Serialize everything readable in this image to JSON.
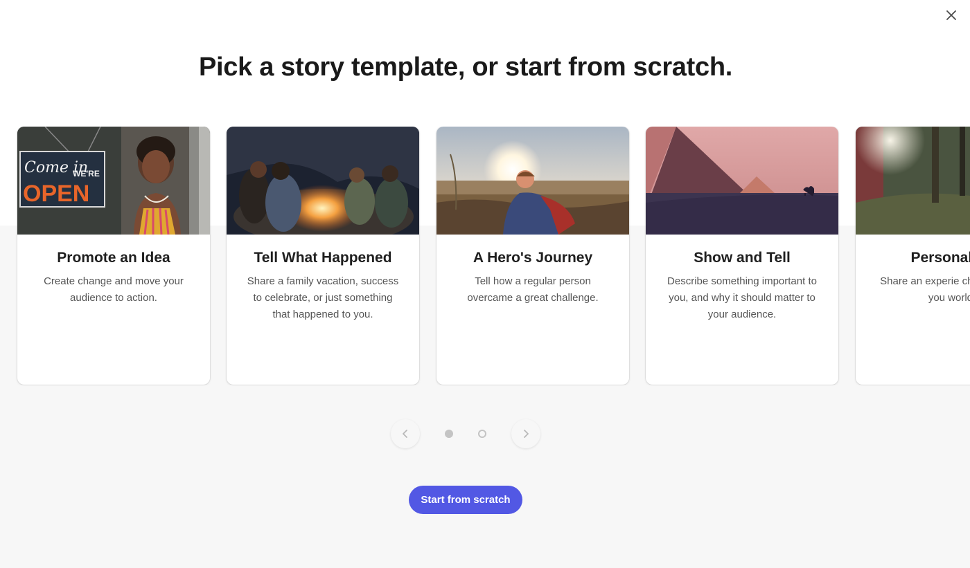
{
  "dialog": {
    "title": "Pick a story template, or start from scratch.",
    "close_icon": "close-icon"
  },
  "templates": [
    {
      "title": "Promote an Idea",
      "description": "Create change and move your audience to action.",
      "image": "open-sign-storefront-photo"
    },
    {
      "title": "Tell What Happened",
      "description": "Share a family vacation, success to celebrate, or just something that happened to you.",
      "image": "campfire-night-photo"
    },
    {
      "title": "A Hero's Journey",
      "description": "Tell how a regular person overcame a great challenge.",
      "image": "child-in-cape-wheat-field-photo"
    },
    {
      "title": "Show and Tell",
      "description": "Describe something important to you, and why it should matter to your audience.",
      "image": "pyramids-sunset-photo"
    },
    {
      "title": "Personal Gr",
      "description": "Share an experie changed how you world.",
      "image": "forest-walk-photo"
    }
  ],
  "pager": {
    "prev_icon": "chevron-left-icon",
    "next_icon": "chevron-right-icon",
    "pages": 2,
    "current_page": 1
  },
  "cta": {
    "label": "Start from scratch",
    "color": "#5258e4"
  }
}
